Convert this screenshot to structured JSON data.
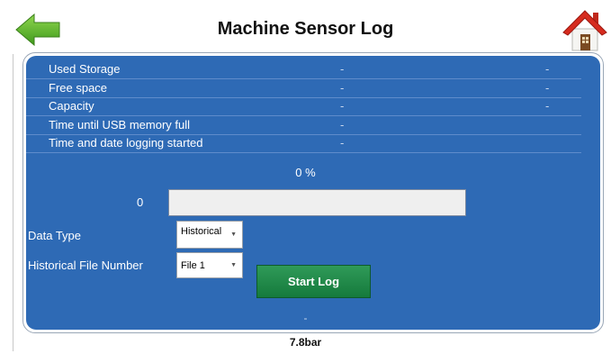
{
  "header": {
    "title": "Machine Sensor Log",
    "back_icon": "arrow-left-icon",
    "home_icon": "home-icon"
  },
  "info_rows": [
    {
      "label": "Used Storage",
      "value": "-",
      "value2": "-"
    },
    {
      "label": "Free space",
      "value": "-",
      "value2": "-"
    },
    {
      "label": "Capacity",
      "value": "-",
      "value2": "-"
    },
    {
      "label": "Time until USB memory full",
      "value": "-",
      "value2": ""
    },
    {
      "label": "Time and date logging started",
      "value": "-",
      "value2": ""
    }
  ],
  "progress": {
    "percent_text": "0 %",
    "count": "0",
    "fraction": 0
  },
  "data_type": {
    "label": "Data Type",
    "selected": "Historical"
  },
  "file_number": {
    "label": "Historical File Number",
    "selected": "File 1"
  },
  "start_button": {
    "label": "Start Log"
  },
  "footer": {
    "dash": "-",
    "status": "7.8bar"
  },
  "colors": {
    "panel": "#2e6ab5",
    "button": "#1f8a49",
    "back_arrow": "#5ab82e",
    "home_roof": "#d62b1e"
  }
}
